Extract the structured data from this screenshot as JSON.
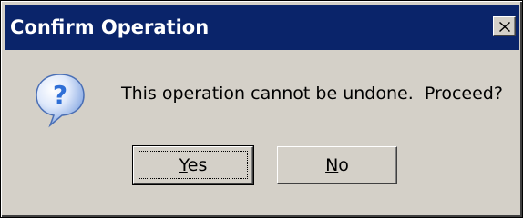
{
  "window": {
    "title": "Confirm Operation",
    "close_icon": "close-icon"
  },
  "dialog": {
    "icon": "question-icon",
    "icon_glyph": "?",
    "message": "This operation cannot be undone.  Proceed?"
  },
  "buttons": {
    "yes": {
      "mnemonic": "Y",
      "rest": "es",
      "focused": true
    },
    "no": {
      "mnemonic": "N",
      "rest": "o",
      "focused": false
    }
  },
  "colors": {
    "titlebar": "#0a246a",
    "face": "#d4d0c8",
    "icon_blue": "#2f6fd6"
  }
}
